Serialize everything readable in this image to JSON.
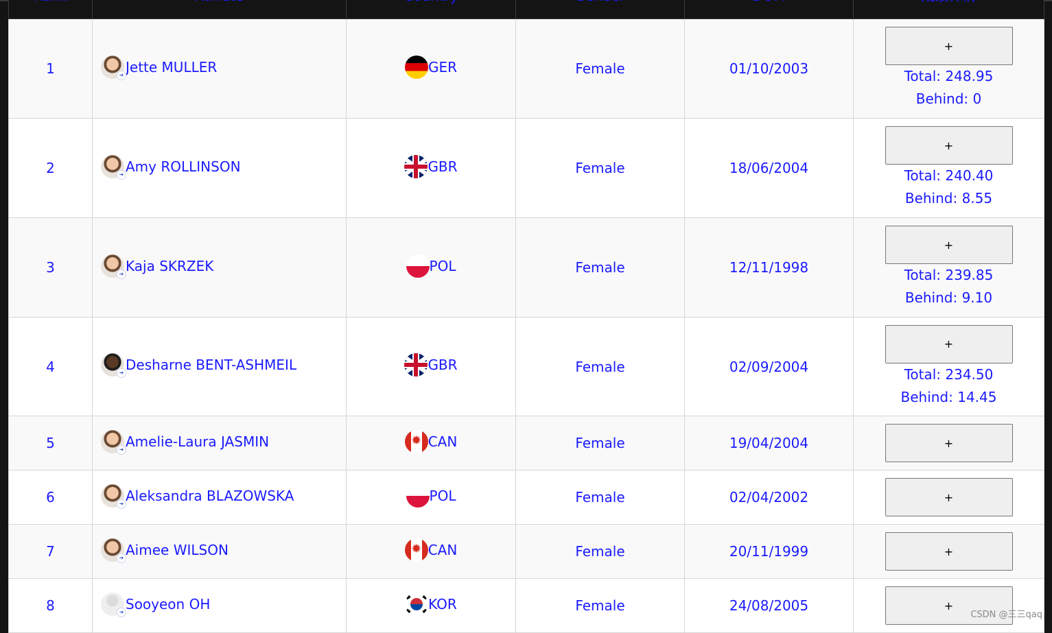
{
  "table": {
    "headers": {
      "rank": "Rank",
      "athlete": "Athlete",
      "country": "Country",
      "gender": "Gender",
      "dob": "DOM",
      "detail": "成绩详情"
    },
    "rows": [
      {
        "rank": "1",
        "name": "Jette MULLER",
        "avatar": "face-icon",
        "country": "GER",
        "flag": "germany-flag-icon",
        "gender": "Female",
        "dob": "01/10/2003",
        "button": "+",
        "total": "Total: 248.95",
        "behind": "Behind: 0"
      },
      {
        "rank": "2",
        "name": "Amy ROLLINSON",
        "avatar": "face-icon",
        "country": "GBR",
        "flag": "uk-flag-icon",
        "gender": "Female",
        "dob": "18/06/2004",
        "button": "+",
        "total": "Total: 240.40",
        "behind": "Behind: 8.55"
      },
      {
        "rank": "3",
        "name": "Kaja SKRZEK",
        "avatar": "face-icon",
        "country": "POL",
        "flag": "poland-flag-icon",
        "gender": "Female",
        "dob": "12/11/1998",
        "button": "+",
        "total": "Total: 239.85",
        "behind": "Behind: 9.10"
      },
      {
        "rank": "4",
        "name": "Desharne BENT-ASHMEIL",
        "avatar": "face-icon",
        "country": "GBR",
        "flag": "uk-flag-icon",
        "gender": "Female",
        "dob": "02/09/2004",
        "button": "+",
        "total": "Total: 234.50",
        "behind": "Behind: 14.45"
      },
      {
        "rank": "5",
        "name": "Amelie-Laura JASMIN",
        "avatar": "face-icon",
        "country": "CAN",
        "flag": "canada-flag-icon",
        "gender": "Female",
        "dob": "19/04/2004",
        "button": "+"
      },
      {
        "rank": "6",
        "name": "Aleksandra BLAZOWSKA",
        "avatar": "face-icon",
        "country": "POL",
        "flag": "poland-flag-icon",
        "gender": "Female",
        "dob": "02/04/2002",
        "button": "+"
      },
      {
        "rank": "7",
        "name": "Aimee WILSON",
        "avatar": "face-icon",
        "country": "CAN",
        "flag": "canada-flag-icon",
        "gender": "Female",
        "dob": "20/11/1999",
        "button": "+"
      },
      {
        "rank": "8",
        "name": "Sooyeon OH",
        "avatar": "placeholder-avatar-icon",
        "country": "KOR",
        "flag": "korea-flag-icon",
        "gender": "Female",
        "dob": "24/08/2005",
        "button": "+"
      }
    ]
  },
  "watermark": "CSDN @三三qaq",
  "colors": {
    "text": "#1a1aff",
    "row_bg": "#f9f9f9",
    "row_alt_bg": "#ffffff",
    "page_bg": "#141414",
    "button_bg": "#efefef"
  }
}
